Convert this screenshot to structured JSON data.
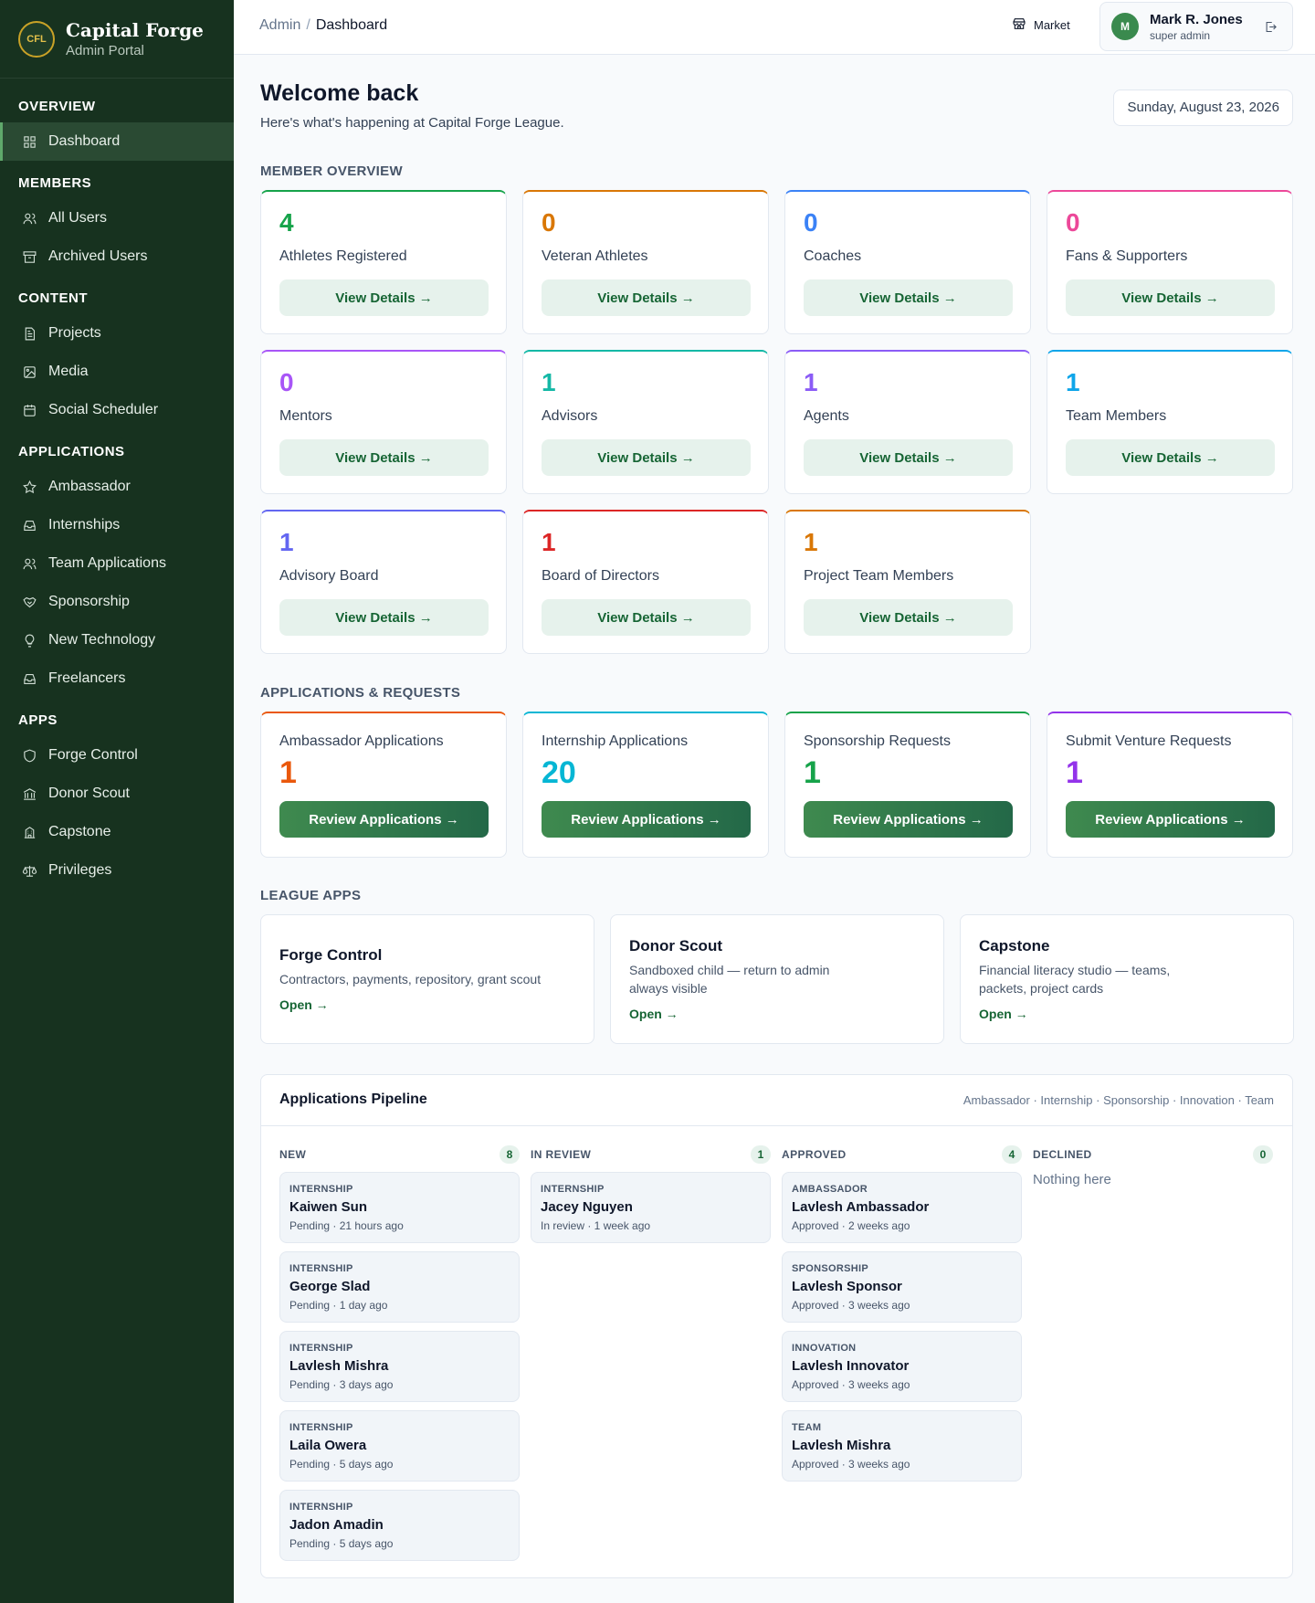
{
  "brand": {
    "name": "Capital Forge",
    "sub": "Admin Portal",
    "logo_text": "CFL"
  },
  "sidebar": {
    "sections": [
      {
        "title": "OVERVIEW",
        "items": [
          {
            "label": "Dashboard",
            "icon": "grid-icon",
            "active": true
          }
        ]
      },
      {
        "title": "MEMBERS",
        "items": [
          {
            "label": "All Users",
            "icon": "users-icon"
          },
          {
            "label": "Archived Users",
            "icon": "archive-icon"
          }
        ]
      },
      {
        "title": "CONTENT",
        "items": [
          {
            "label": "Projects",
            "icon": "file-icon"
          },
          {
            "label": "Media",
            "icon": "image-icon"
          },
          {
            "label": "Social Scheduler",
            "icon": "calendar-icon"
          }
        ]
      },
      {
        "title": "APPLICATIONS",
        "items": [
          {
            "label": "Ambassador",
            "icon": "star-icon"
          },
          {
            "label": "Internships",
            "icon": "inbox-icon"
          },
          {
            "label": "Team Applications",
            "icon": "users-icon"
          },
          {
            "label": "Sponsorship",
            "icon": "handshake-icon"
          },
          {
            "label": "New Technology",
            "icon": "lightbulb-icon"
          },
          {
            "label": "Freelancers",
            "icon": "inbox-icon"
          }
        ]
      },
      {
        "title": "APPS",
        "items": [
          {
            "label": "Forge Control",
            "icon": "shield-icon"
          },
          {
            "label": "Donor Scout",
            "icon": "bank-icon"
          },
          {
            "label": "Capstone",
            "icon": "building-icon"
          },
          {
            "label": "Privileges",
            "icon": "scale-icon"
          }
        ]
      }
    ]
  },
  "topbar": {
    "breadcrumb_root": "Admin",
    "breadcrumb_sep": "/",
    "breadcrumb_current": "Dashboard",
    "market_label": "Market",
    "user": {
      "initial": "M",
      "name": "Mark R. Jones",
      "role": "super admin"
    }
  },
  "welcome": {
    "title": "Welcome back",
    "subtitle": "Here's what's happening at Capital Forge League.",
    "date": "Sunday, August 23, 2026"
  },
  "member_overview": {
    "title": "MEMBER OVERVIEW",
    "button_label": "View Details →",
    "cards": [
      {
        "value": "4",
        "label": "Athletes Registered",
        "color": "#16a34a"
      },
      {
        "value": "0",
        "label": "Veteran Athletes",
        "color": "#d97706"
      },
      {
        "value": "0",
        "label": "Coaches",
        "color": "#3b82f6"
      },
      {
        "value": "0",
        "label": "Fans & Supporters",
        "color": "#ec4899"
      },
      {
        "value": "0",
        "label": "Mentors",
        "color": "#a855f7"
      },
      {
        "value": "1",
        "label": "Advisors",
        "color": "#14b8a6"
      },
      {
        "value": "1",
        "label": "Agents",
        "color": "#8b5cf6"
      },
      {
        "value": "1",
        "label": "Team Members",
        "color": "#0ea5e9"
      },
      {
        "value": "1",
        "label": "Advisory Board",
        "color": "#6366f1"
      },
      {
        "value": "1",
        "label": "Board of Directors",
        "color": "#dc2626"
      },
      {
        "value": "1",
        "label": "Project Team Members",
        "color": "#d97706"
      }
    ]
  },
  "applications": {
    "title": "APPLICATIONS & REQUESTS",
    "button_label": "Review Applications →",
    "cards": [
      {
        "label": "Ambassador Applications",
        "value": "1",
        "color": "#ea580c"
      },
      {
        "label": "Internship Applications",
        "value": "20",
        "color": "#06b6d4"
      },
      {
        "label": "Sponsorship Requests",
        "value": "1",
        "color": "#16a34a"
      },
      {
        "label": "Submit Venture Requests",
        "value": "1",
        "color": "#9333ea"
      }
    ]
  },
  "league_apps": {
    "title": "LEAGUE APPS",
    "open_label": "Open →",
    "cards": [
      {
        "title": "Forge Control",
        "desc": "Contractors, payments, repository, grant scout"
      },
      {
        "title": "Donor Scout",
        "desc": "Sandboxed child — return to admin always visible"
      },
      {
        "title": "Capstone",
        "desc": "Financial literacy studio — teams, packets, project cards"
      }
    ]
  },
  "pipeline": {
    "title": "Applications Pipeline",
    "tags": "Ambassador · Internship · Sponsorship · Innovation · Team",
    "columns": [
      {
        "title": "NEW",
        "count": "8",
        "items": [
          {
            "type": "INTERNSHIP",
            "name": "Kaiwen Sun",
            "status": "Pending · 21 hours ago"
          },
          {
            "type": "INTERNSHIP",
            "name": "George Slad",
            "status": "Pending · 1 day ago"
          },
          {
            "type": "INTERNSHIP",
            "name": "Lavlesh Mishra",
            "status": "Pending · 3 days ago"
          },
          {
            "type": "INTERNSHIP",
            "name": "Laila Owera",
            "status": "Pending · 5 days ago"
          },
          {
            "type": "INTERNSHIP",
            "name": "Jadon Amadin",
            "status": "Pending · 5 days ago"
          }
        ]
      },
      {
        "title": "IN REVIEW",
        "count": "1",
        "items": [
          {
            "type": "INTERNSHIP",
            "name": "Jacey Nguyen",
            "status": "In review · 1 week ago"
          }
        ]
      },
      {
        "title": "APPROVED",
        "count": "4",
        "items": [
          {
            "type": "AMBASSADOR",
            "name": "Lavlesh Ambassador",
            "status": "Approved · 2 weeks ago"
          },
          {
            "type": "SPONSORSHIP",
            "name": "Lavlesh Sponsor",
            "status": "Approved · 3 weeks ago"
          },
          {
            "type": "INNOVATION",
            "name": "Lavlesh Innovator",
            "status": "Approved · 3 weeks ago"
          },
          {
            "type": "TEAM",
            "name": "Lavlesh Mishra",
            "status": "Approved · 3 weeks ago"
          }
        ]
      },
      {
        "title": "DECLINED",
        "count": "0",
        "items": [],
        "empty": "Nothing here"
      }
    ]
  }
}
